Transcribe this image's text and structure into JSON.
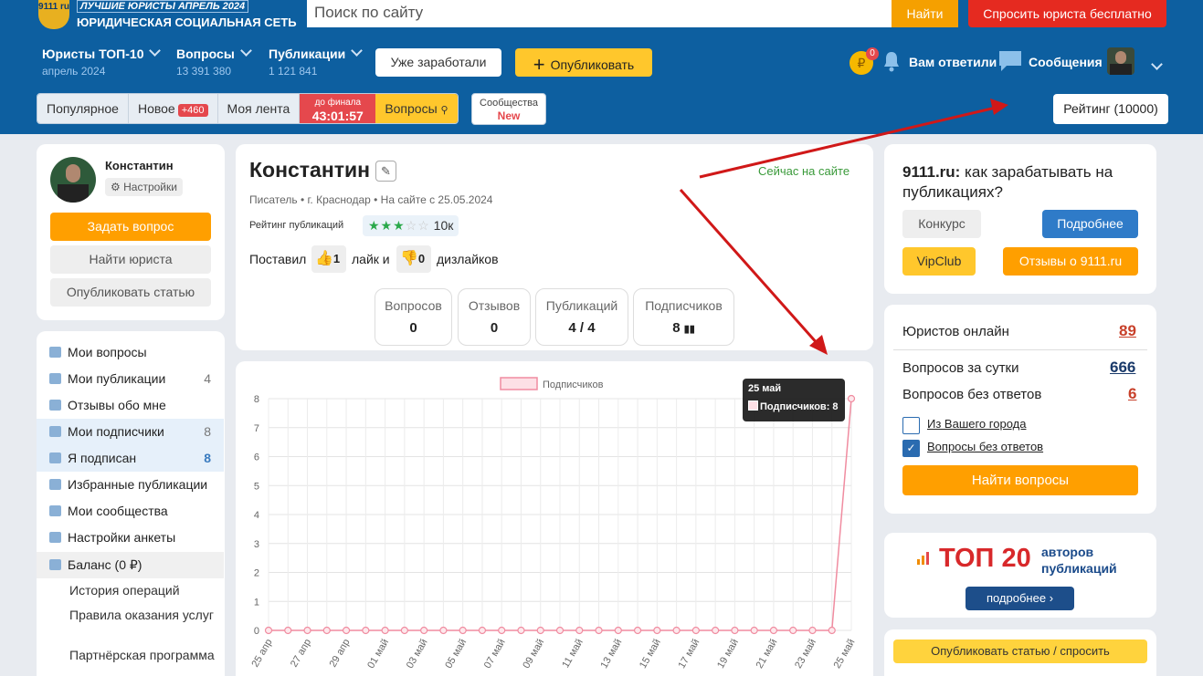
{
  "header": {
    "logo_text": "9111 ru",
    "tagline": "ЛУЧШИЕ ЮРИСТЫ АПРЕЛЬ 2024",
    "network_name": "ЮРИДИЧЕСКАЯ СОЦИАЛЬНАЯ СЕТЬ",
    "search_placeholder": "Поиск по сайту",
    "search_button": "Найти",
    "ask_button": "Спросить юриста бесплатно"
  },
  "nav": {
    "items": [
      {
        "label": "Юристы ТОП-10",
        "sub": "апрель 2024"
      },
      {
        "label": "Вопросы",
        "sub": "13 391 380"
      },
      {
        "label": "Публикации",
        "sub": "1 121 841"
      }
    ],
    "earned_button": "Уже заработали",
    "publish_button": "Опубликовать",
    "coin_badge": "0",
    "answered_label": "Вам ответили",
    "messages_label": "Сообщения"
  },
  "tabs": {
    "popular": "Популярное",
    "new": "Новое",
    "new_badge": "+460",
    "feed": "Моя лента",
    "timer_caption": "до финала",
    "timer_value": "43:01:57",
    "questions": "Вопросы",
    "communities": "Сообщества",
    "communities_badge": "New",
    "rating_button": "Рейтинг (10000)"
  },
  "sidebar_profile": {
    "name": "Константин",
    "settings": "Настройки",
    "ask": "Задать вопрос",
    "find": "Найти юриста",
    "publish": "Опубликовать статью"
  },
  "sidebar_menu": [
    {
      "label": "Мои вопросы",
      "count": ""
    },
    {
      "label": "Мои публикации",
      "count": "4"
    },
    {
      "label": "Отзывы обо мне",
      "count": ""
    },
    {
      "label": "Мои подписчики",
      "count": "8"
    },
    {
      "label": "Я подписан",
      "count": "8"
    },
    {
      "label": "Избранные публикации",
      "count": ""
    },
    {
      "label": "Мои сообщества",
      "count": ""
    },
    {
      "label": "Настройки анкеты",
      "count": ""
    },
    {
      "label": "Баланс (0 ₽)",
      "count": ""
    }
  ],
  "sidebar_sub": [
    "История операций",
    "Правила оказания услуг",
    "Партнёрская программа"
  ],
  "profile": {
    "name": "Константин",
    "online": "Сейчас на сайте",
    "meta": "Писатель • г. Краснодар • На сайте с 25.05.2024",
    "rating_label": "Рейтинг публикаций",
    "rating_value": "10к",
    "likes_prefix": "Поставил",
    "likes": "1",
    "likes_mid": "лайк и",
    "dislikes": "0",
    "dislikes_suffix": "дизлайков",
    "stats": [
      {
        "label": "Вопросов",
        "value": "0"
      },
      {
        "label": "Отзывов",
        "value": "0"
      },
      {
        "label": "Публикаций",
        "value": "4 / 4"
      },
      {
        "label": "Подписчиков",
        "value": "8"
      }
    ]
  },
  "chart_data": {
    "type": "line",
    "legend": "Подписчиков",
    "x": [
      "25 апр",
      "26 апр",
      "27 апр",
      "28 апр",
      "29 апр",
      "30 апр",
      "01 май",
      "02 май",
      "03 май",
      "04 май",
      "05 май",
      "06 май",
      "07 май",
      "08 май",
      "09 май",
      "10 май",
      "11 май",
      "12 май",
      "13 май",
      "14 май",
      "15 май",
      "16 май",
      "17 май",
      "18 май",
      "19 май",
      "20 май",
      "21 май",
      "22 май",
      "23 май",
      "24 май",
      "25 май"
    ],
    "tick_labels": [
      "25 апр",
      "27 апр",
      "29 апр",
      "01 май",
      "03 май",
      "05 май",
      "07 май",
      "09 май",
      "11 май",
      "13 май",
      "15 май",
      "17 май",
      "19 май",
      "21 май",
      "23 май",
      "25 май"
    ],
    "values": [
      0,
      0,
      0,
      0,
      0,
      0,
      0,
      0,
      0,
      0,
      0,
      0,
      0,
      0,
      0,
      0,
      0,
      0,
      0,
      0,
      0,
      0,
      0,
      0,
      0,
      0,
      0,
      0,
      0,
      0,
      8
    ],
    "ylim": [
      0,
      8
    ],
    "yticks": [
      "0",
      "1",
      "2",
      "3",
      "4",
      "5",
      "6",
      "7",
      "8"
    ],
    "tooltip_title": "25 май",
    "tooltip_text": "Подписчиков: 8",
    "color": "#f08ca0"
  },
  "promo": {
    "title_bold": "9111.ru:",
    "title_rest": " как зарабатывать на публикациях?",
    "contest": "Конкурс",
    "more": "Подробнее",
    "vip": "VipClub",
    "reviews": "Отзывы о 9111.ru"
  },
  "stats_box": {
    "online_label": "Юристов онлайн",
    "online_value": "89",
    "day_label": "Вопросов за сутки",
    "day_value": "666",
    "unanswered_label": "Вопросов без ответов",
    "unanswered_value": "6",
    "city_check": "Из Вашего города",
    "noanswer_check": "Вопросы без ответов",
    "find_button": "Найти вопросы"
  },
  "top20": {
    "title": "ТОП 20",
    "sub1": "авторов",
    "sub2": "публикаций",
    "more": "подробнее"
  },
  "bottom_button": "Опубликовать статью / спросить"
}
